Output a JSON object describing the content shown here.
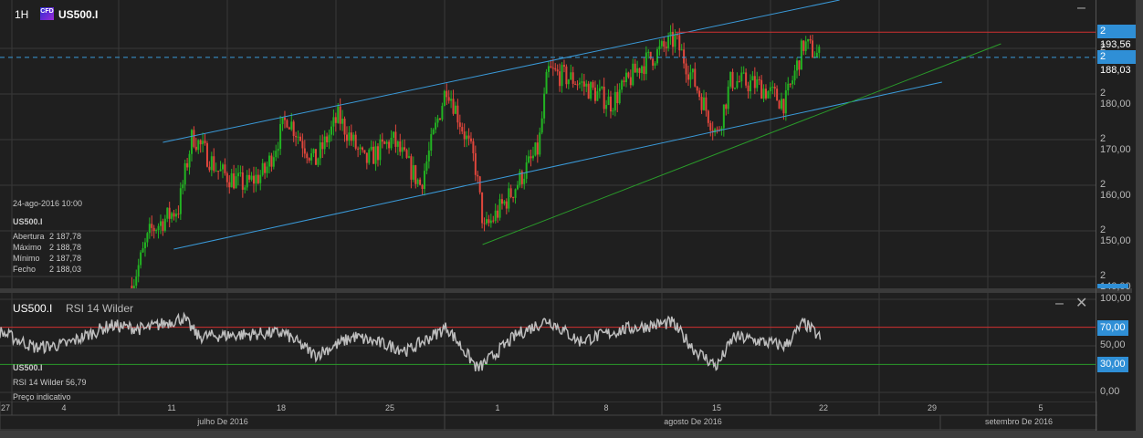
{
  "header": {
    "timeframe": "1H",
    "symbol": "US500.I",
    "badge": "CFD"
  },
  "info": {
    "datetime": "24-ago-2016 10:00",
    "symbol": "US500.I",
    "rows": [
      {
        "label": "Abertura",
        "value": "2 187,78"
      },
      {
        "label": "Máximo",
        "value": "2 188,78"
      },
      {
        "label": "Mínimo",
        "value": "2 187,78"
      },
      {
        "label": "Fecho",
        "value": "2 188,03"
      }
    ]
  },
  "price_axis": {
    "ticks": [
      "2 190,00",
      "2 180,00",
      "2 170,00",
      "2 160,00",
      "2 150,00",
      "2 140,00"
    ],
    "tick_values": [
      2190,
      2180,
      2170,
      2160,
      2150,
      2140
    ],
    "resistance_label": "2 193,56",
    "resistance": 2193.56,
    "last_label": "2 188,03",
    "last": 2188.03
  },
  "rsi": {
    "title_symbol": "US500.I",
    "title": "RSI 14 Wilder",
    "ticks": [
      "100,00",
      "50,00",
      "0,00"
    ],
    "tick_values": [
      100,
      50,
      0
    ],
    "upper_label": "70,00",
    "upper": 70,
    "lower_label": "30,00",
    "lower": 30,
    "info_symbol": "US500.I",
    "info_value": "RSI 14 Wilder  56,79",
    "info_note": "Preço indicativo"
  },
  "time_axis": {
    "days": [
      "27",
      "4",
      "11",
      "18",
      "25",
      "1",
      "8",
      "15",
      "22",
      "29",
      "5"
    ],
    "months": [
      "julho De 2016",
      "agosto De 2016",
      "setembro De 2016"
    ]
  },
  "colors": {
    "up": "#22b322",
    "down": "#e0463c",
    "channel": "#3a9ad9",
    "support": "#2a9a2a",
    "resistance": "#d03030",
    "rsi": "#bdbdbd"
  },
  "chart_data": {
    "type": "candlestick",
    "x_unit": "days since 27-jun-2016",
    "price_path": [
      [
        8.2,
        2138
      ],
      [
        9.4,
        2150
      ],
      [
        11.2,
        2155
      ],
      [
        12.1,
        2171
      ],
      [
        13.8,
        2163
      ],
      [
        15.5,
        2160
      ],
      [
        16.8,
        2163
      ],
      [
        18.2,
        2175
      ],
      [
        20,
        2165
      ],
      [
        21.5,
        2175
      ],
      [
        23.2,
        2165
      ],
      [
        25,
        2170
      ],
      [
        26.8,
        2160
      ],
      [
        28.5,
        2182
      ],
      [
        30.3,
        2165
      ],
      [
        30.9,
        2150
      ],
      [
        32.6,
        2158
      ],
      [
        34.4,
        2168
      ],
      [
        35,
        2185
      ],
      [
        36.8,
        2183
      ],
      [
        39.1,
        2178
      ],
      [
        40.9,
        2186
      ],
      [
        43.2,
        2192
      ],
      [
        44.4,
        2183
      ],
      [
        45.9,
        2171
      ],
      [
        46.8,
        2183
      ],
      [
        48.5,
        2182
      ],
      [
        50.3,
        2178
      ],
      [
        51.5,
        2191
      ],
      [
        52.6,
        2188
      ]
    ],
    "rsi_path": [
      [
        -0.3,
        65
      ],
      [
        2,
        48
      ],
      [
        4,
        52
      ],
      [
        6.8,
        72
      ],
      [
        9,
        68
      ],
      [
        11.5,
        80
      ],
      [
        12.5,
        60
      ],
      [
        18,
        64
      ],
      [
        20,
        40
      ],
      [
        22.5,
        60
      ],
      [
        26,
        45
      ],
      [
        28.5,
        70
      ],
      [
        30.5,
        25
      ],
      [
        33,
        62
      ],
      [
        35,
        78
      ],
      [
        37,
        55
      ],
      [
        40,
        68
      ],
      [
        43,
        75
      ],
      [
        44.5,
        45
      ],
      [
        45.9,
        28
      ],
      [
        47,
        60
      ],
      [
        50.3,
        50
      ],
      [
        51.5,
        75
      ],
      [
        52.6,
        58
      ]
    ],
    "trendlines": [
      {
        "name": "channel-upper",
        "from": [
          10.2,
          2169.4
        ],
        "to": [
          53.8,
          2200.6
        ]
      },
      {
        "name": "channel-lower",
        "from": [
          10.9,
          2146
        ],
        "to": [
          60.4,
          2182.6
        ]
      },
      {
        "name": "support",
        "from": [
          30.8,
          2147
        ],
        "to": [
          64.2,
          2191
        ]
      }
    ]
  }
}
